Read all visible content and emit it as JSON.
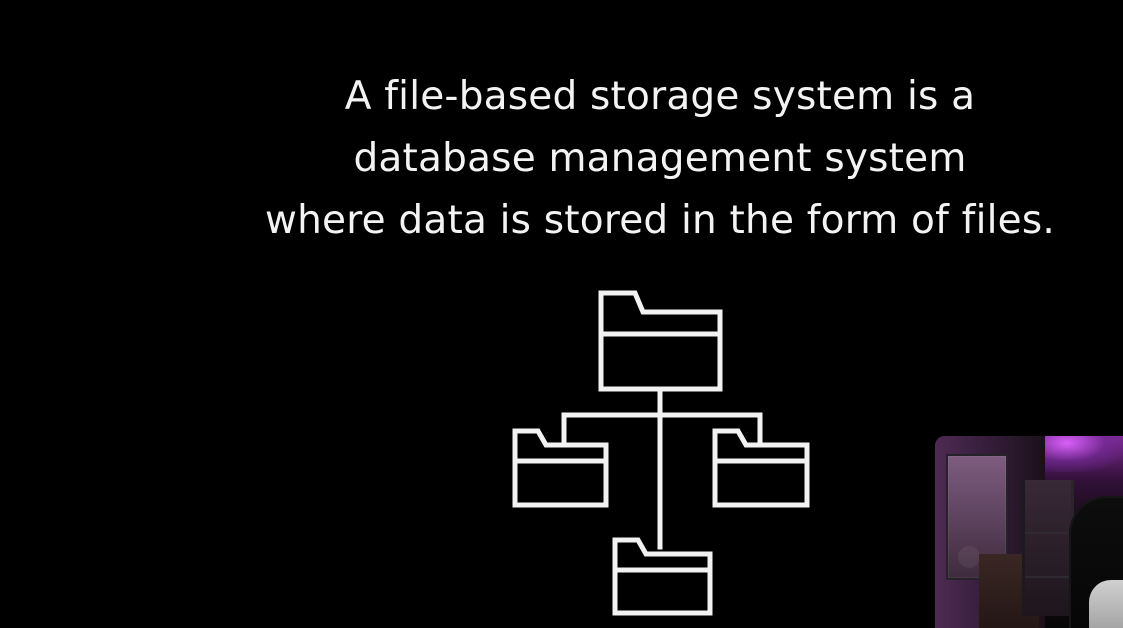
{
  "slide": {
    "caption": {
      "lines": [
        "A file-based storage system is a",
        "database management system",
        "where data is stored in the form of files."
      ]
    },
    "graphic": {
      "name": "folder-hierarchy",
      "icon": "folder-tree-icon"
    },
    "overlay": {
      "name": "presenter-webcam"
    },
    "colors": {
      "background": "#000000",
      "foreground": "#f3f3f3",
      "webcam_accent": "#b455f0"
    }
  }
}
